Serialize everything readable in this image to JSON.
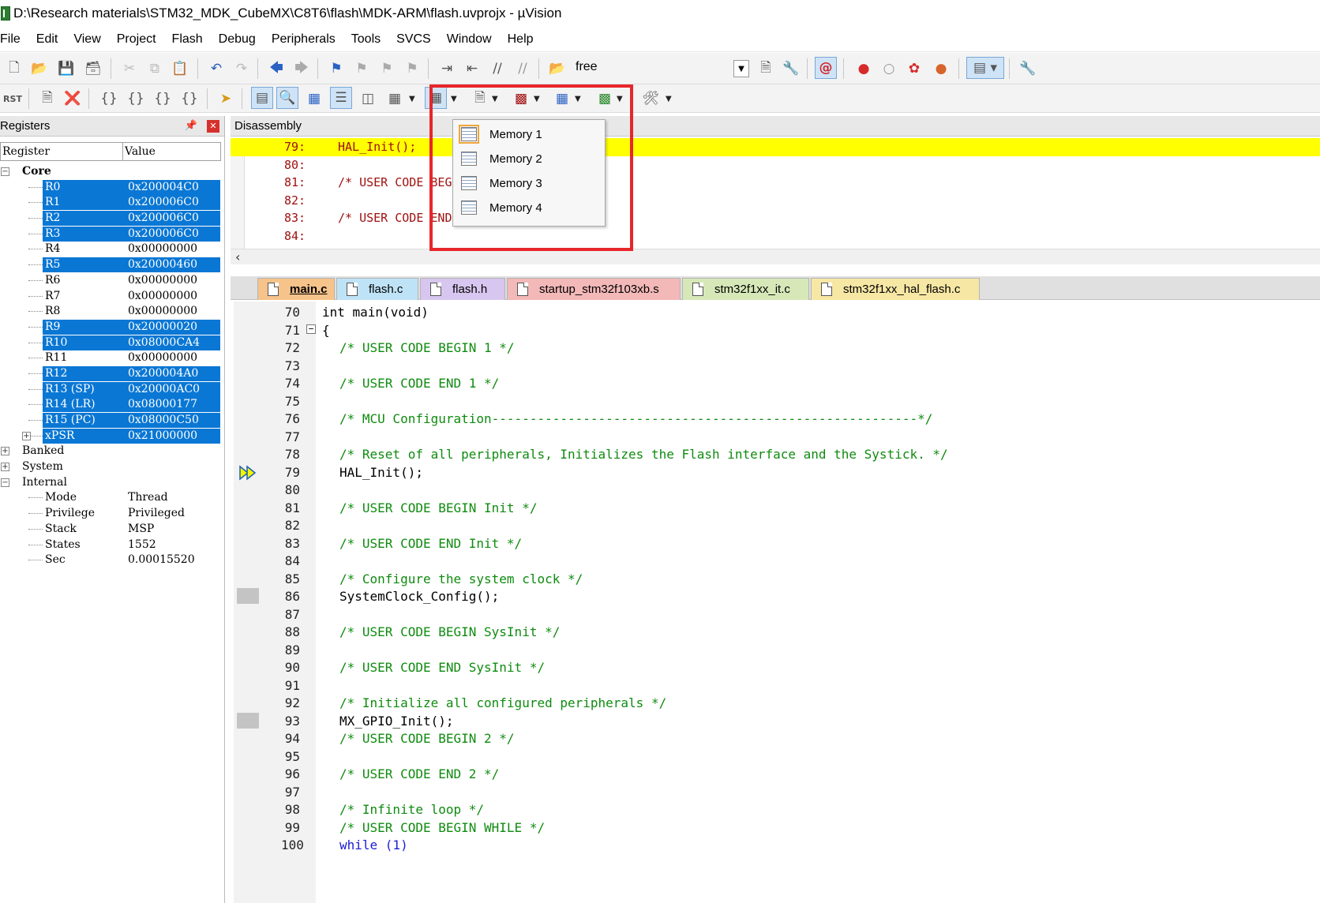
{
  "window": {
    "title": "D:\\Research materials\\STM32_MDK_CubeMX\\C8T6\\flash\\MDK-ARM\\flash.uvprojx - µVision"
  },
  "menubar": [
    "File",
    "Edit",
    "View",
    "Project",
    "Flash",
    "Debug",
    "Peripherals",
    "Tools",
    "SVCS",
    "Window",
    "Help"
  ],
  "toolbar": {
    "target_name": "free"
  },
  "registers_panel": {
    "title": "Registers",
    "columns": [
      "Register",
      "Value"
    ],
    "core_label": "Core",
    "registers": [
      {
        "name": "R0",
        "value": "0x200004C0",
        "selected": true
      },
      {
        "name": "R1",
        "value": "0x200006C0",
        "selected": true
      },
      {
        "name": "R2",
        "value": "0x200006C0",
        "selected": true
      },
      {
        "name": "R3",
        "value": "0x200006C0",
        "selected": true
      },
      {
        "name": "R4",
        "value": "0x00000000",
        "selected": false
      },
      {
        "name": "R5",
        "value": "0x20000460",
        "selected": true
      },
      {
        "name": "R6",
        "value": "0x00000000",
        "selected": false
      },
      {
        "name": "R7",
        "value": "0x00000000",
        "selected": false
      },
      {
        "name": "R8",
        "value": "0x00000000",
        "selected": false
      },
      {
        "name": "R9",
        "value": "0x20000020",
        "selected": true
      },
      {
        "name": "R10",
        "value": "0x08000CA4",
        "selected": true
      },
      {
        "name": "R11",
        "value": "0x00000000",
        "selected": false
      },
      {
        "name": "R12",
        "value": "0x200004A0",
        "selected": true
      },
      {
        "name": "R13 (SP)",
        "value": "0x20000AC0",
        "selected": true
      },
      {
        "name": "R14 (LR)",
        "value": "0x08000177",
        "selected": true
      },
      {
        "name": "R15 (PC)",
        "value": "0x08000C50",
        "selected": true
      },
      {
        "name": "xPSR",
        "value": "0x21000000",
        "selected": true
      }
    ],
    "groups": [
      "Banked",
      "System",
      "Internal"
    ],
    "internal": [
      {
        "name": "Mode",
        "value": "Thread"
      },
      {
        "name": "Privilege",
        "value": "Privileged"
      },
      {
        "name": "Stack",
        "value": "MSP"
      },
      {
        "name": "States",
        "value": "1552"
      },
      {
        "name": "Sec",
        "value": "0.00015520"
      }
    ]
  },
  "disassembly": {
    "title": "Disassembly",
    "lines": [
      {
        "num": "79:",
        "text": "HAL_Init();",
        "current": true
      },
      {
        "num": "80:",
        "text": "",
        "current": false
      },
      {
        "num": "81:",
        "text": "/* USER CODE BEGIN Init */",
        "current": false
      },
      {
        "num": "82:",
        "text": "",
        "current": false
      },
      {
        "num": "83:",
        "text": "/* USER CODE END Init */",
        "current": false
      },
      {
        "num": "84:",
        "text": "",
        "current": false
      }
    ]
  },
  "memory_menu": {
    "items": [
      "Memory 1",
      "Memory 2",
      "Memory 3",
      "Memory 4"
    ]
  },
  "editor": {
    "tabs": [
      {
        "label": "main.c",
        "color": "#f6c38a",
        "active": true
      },
      {
        "label": "flash.c",
        "color": "#bfe3f6",
        "active": false
      },
      {
        "label": "flash.h",
        "color": "#d7c6ef",
        "active": false
      },
      {
        "label": "startup_stm32f103xb.s",
        "color": "#f3b8b8",
        "active": false
      },
      {
        "label": "stm32f1xx_it.c",
        "color": "#d6e8b8",
        "active": false
      },
      {
        "label": "stm32f1xx_hal_flash.c",
        "color": "#f7e7a4",
        "active": false
      }
    ],
    "lines": [
      {
        "num": "70",
        "text": "int main(void)",
        "kind": "plain"
      },
      {
        "num": "71",
        "text": "{",
        "kind": "plain"
      },
      {
        "num": "72",
        "text": "/* USER CODE BEGIN 1 */",
        "kind": "comment"
      },
      {
        "num": "73",
        "text": "",
        "kind": "plain"
      },
      {
        "num": "74",
        "text": "/* USER CODE END 1 */",
        "kind": "comment"
      },
      {
        "num": "75",
        "text": "",
        "kind": "plain"
      },
      {
        "num": "76",
        "text": "/* MCU Configuration--------------------------------------------------------*/",
        "kind": "comment"
      },
      {
        "num": "77",
        "text": "",
        "kind": "plain"
      },
      {
        "num": "78",
        "text": "/* Reset of all peripherals, Initializes the Flash interface and the Systick. */",
        "kind": "comment"
      },
      {
        "num": "79",
        "text": "HAL_Init();",
        "kind": "plain"
      },
      {
        "num": "80",
        "text": "",
        "kind": "plain"
      },
      {
        "num": "81",
        "text": "/* USER CODE BEGIN Init */",
        "kind": "comment"
      },
      {
        "num": "82",
        "text": "",
        "kind": "plain"
      },
      {
        "num": "83",
        "text": "/* USER CODE END Init */",
        "kind": "comment"
      },
      {
        "num": "84",
        "text": "",
        "kind": "plain"
      },
      {
        "num": "85",
        "text": "/* Configure the system clock */",
        "kind": "comment"
      },
      {
        "num": "86",
        "text": "SystemClock_Config();",
        "kind": "plain"
      },
      {
        "num": "87",
        "text": "",
        "kind": "plain"
      },
      {
        "num": "88",
        "text": "/* USER CODE BEGIN SysInit */",
        "kind": "comment"
      },
      {
        "num": "89",
        "text": "",
        "kind": "plain"
      },
      {
        "num": "90",
        "text": "/* USER CODE END SysInit */",
        "kind": "comment"
      },
      {
        "num": "91",
        "text": "",
        "kind": "plain"
      },
      {
        "num": "92",
        "text": "/* Initialize all configured peripherals */",
        "kind": "comment"
      },
      {
        "num": "93",
        "text": "MX_GPIO_Init();",
        "kind": "plain"
      },
      {
        "num": "94",
        "text": "/* USER CODE BEGIN 2 */",
        "kind": "comment"
      },
      {
        "num": "95",
        "text": "",
        "kind": "plain"
      },
      {
        "num": "96",
        "text": "/* USER CODE END 2 */",
        "kind": "comment"
      },
      {
        "num": "97",
        "text": "",
        "kind": "plain"
      },
      {
        "num": "98",
        "text": "/* Infinite loop */",
        "kind": "comment"
      },
      {
        "num": "99",
        "text": "/* USER CODE BEGIN WHILE */",
        "kind": "comment"
      },
      {
        "num": "100",
        "text": "while (1)",
        "kind": "plain"
      }
    ]
  }
}
